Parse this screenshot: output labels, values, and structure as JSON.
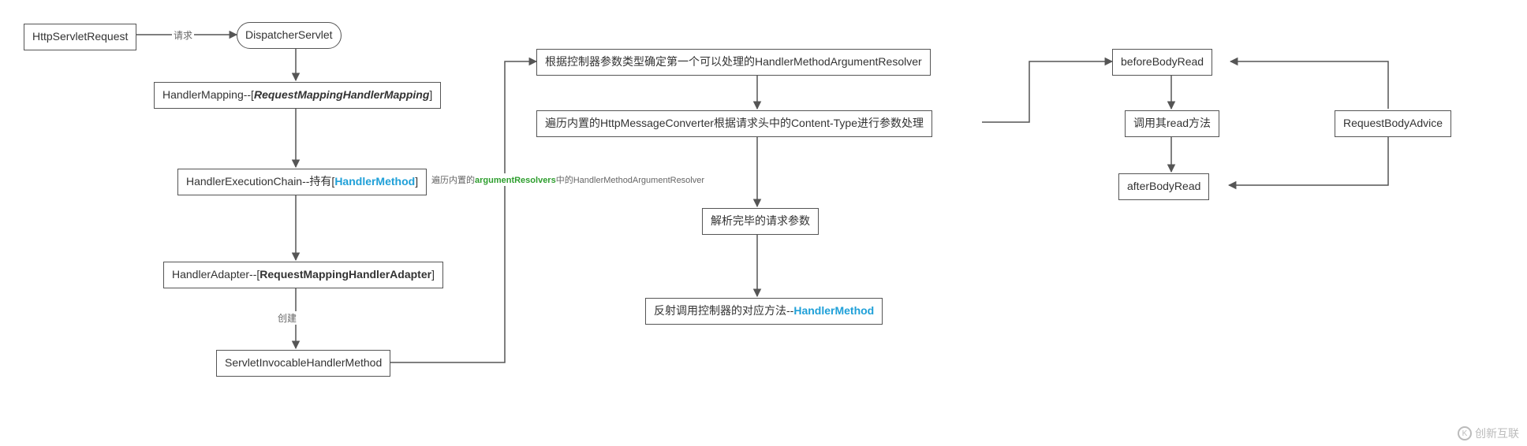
{
  "nodes": {
    "httpServletRequest": "HttpServletRequest",
    "dispatcherServlet": "DispatcherServlet",
    "handlerMapping_prefix": "HandlerMapping--[",
    "handlerMapping_em": "RequestMappingHandlerMapping",
    "handlerMapping_suffix": "]",
    "handlerExecChain_prefix": "HandlerExecutionChain--持有[",
    "handlerExecChain_link": "HandlerMethod",
    "handlerExecChain_suffix": "]",
    "handlerAdapter_prefix": "HandlerAdapter--[",
    "handlerAdapter_bold": "RequestMappingHandlerAdapter",
    "handlerAdapter_suffix": "]",
    "servletInvocable": "ServletInvocableHandlerMethod",
    "resolverPick": "根据控制器参数类型确定第一个可以处理的HandlerMethodArgumentResolver",
    "converterTraverse": "遍历内置的HttpMessageConverter根据请求头中的Content-Type进行参数处理",
    "parsedParams": "解析完毕的请求参数",
    "reflectCall_prefix": "反射调用控制器的对应方法--",
    "reflectCall_link": "HandlerMethod",
    "beforeBodyRead": "beforeBodyRead",
    "callRead": "调用其read方法",
    "afterBodyRead": "afterBodyRead",
    "requestBodyAdvice": "RequestBodyAdvice"
  },
  "edgeLabels": {
    "request": "请求",
    "create": "创建",
    "traverseResolvers_prefix": "遍历内置的",
    "traverseResolvers_mid": "argumentResolvers",
    "traverseResolvers_suffix": "中的HandlerMethodArgumentResolver"
  },
  "watermark": {
    "text": "创新互联",
    "icon": "K"
  }
}
